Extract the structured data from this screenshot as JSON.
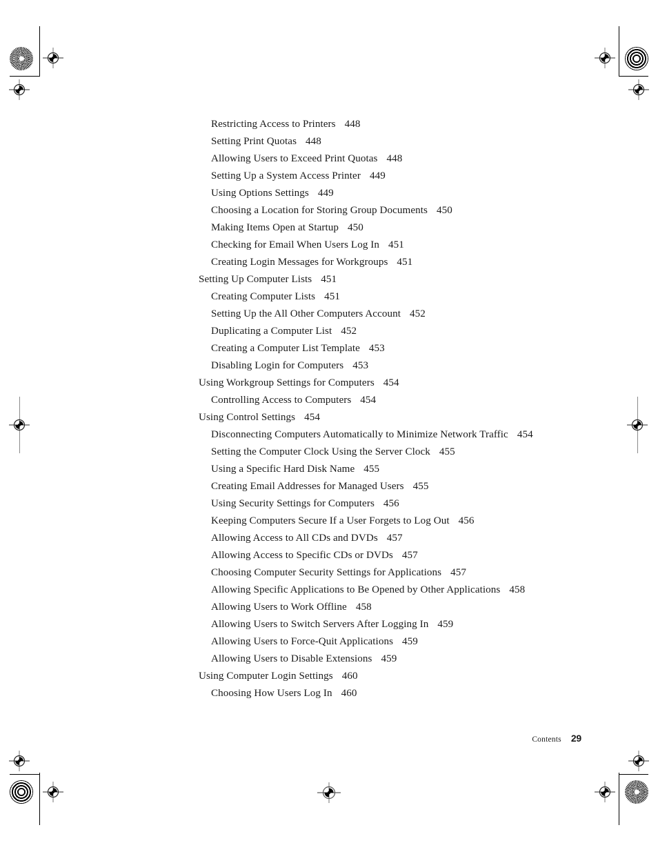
{
  "page": {
    "footer_label": "Contents",
    "page_number": "29"
  },
  "toc": {
    "entries": [
      {
        "title": "Restricting Access to Printers",
        "page": "448",
        "level": 2
      },
      {
        "title": "Setting Print Quotas",
        "page": "448",
        "level": 2
      },
      {
        "title": "Allowing Users to Exceed Print Quotas",
        "page": "448",
        "level": 2
      },
      {
        "title": "Setting Up a System Access Printer",
        "page": "449",
        "level": 2
      },
      {
        "title": "Using Options Settings",
        "page": "449",
        "level": 2
      },
      {
        "title": "Choosing a Location for Storing Group Documents",
        "page": "450",
        "level": 2
      },
      {
        "title": "Making Items Open at Startup",
        "page": "450",
        "level": 2
      },
      {
        "title": "Checking for Email When Users Log In",
        "page": "451",
        "level": 2
      },
      {
        "title": "Creating Login Messages for Workgroups",
        "page": "451",
        "level": 2
      },
      {
        "title": "Setting Up Computer Lists",
        "page": "451",
        "level": 1
      },
      {
        "title": "Creating Computer Lists",
        "page": "451",
        "level": 2
      },
      {
        "title": "Setting Up the All Other Computers Account",
        "page": "452",
        "level": 2
      },
      {
        "title": "Duplicating a Computer List",
        "page": "452",
        "level": 2
      },
      {
        "title": "Creating a Computer List Template",
        "page": "453",
        "level": 2
      },
      {
        "title": "Disabling Login for Computers",
        "page": "453",
        "level": 2
      },
      {
        "title": "Using Workgroup Settings for Computers",
        "page": "454",
        "level": 1
      },
      {
        "title": "Controlling Access to Computers",
        "page": "454",
        "level": 2
      },
      {
        "title": "Using Control Settings",
        "page": "454",
        "level": 1
      },
      {
        "title": "Disconnecting Computers Automatically to Minimize Network Traffic",
        "page": "454",
        "level": 2
      },
      {
        "title": "Setting the Computer Clock Using the Server Clock",
        "page": "455",
        "level": 2
      },
      {
        "title": "Using a Specific Hard Disk Name",
        "page": "455",
        "level": 2
      },
      {
        "title": "Creating Email Addresses for Managed Users",
        "page": "455",
        "level": 2
      },
      {
        "title": "Using Security Settings for Computers",
        "page": "456",
        "level": 2
      },
      {
        "title": "Keeping Computers Secure If a User Forgets to Log Out",
        "page": "456",
        "level": 2
      },
      {
        "title": "Allowing Access to All CDs and DVDs",
        "page": "457",
        "level": 2
      },
      {
        "title": "Allowing Access to Specific CDs or DVDs",
        "page": "457",
        "level": 2
      },
      {
        "title": "Choosing Computer Security Settings for Applications",
        "page": "457",
        "level": 2
      },
      {
        "title": "Allowing Specific Applications to Be Opened by Other Applications",
        "page": "458",
        "level": 2
      },
      {
        "title": "Allowing Users to Work Offline",
        "page": "458",
        "level": 2
      },
      {
        "title": "Allowing Users to Switch Servers After Logging In",
        "page": "459",
        "level": 2
      },
      {
        "title": "Allowing Users to Force-Quit Applications",
        "page": "459",
        "level": 2
      },
      {
        "title": "Allowing Users to Disable Extensions",
        "page": "459",
        "level": 2
      },
      {
        "title": "Using Computer Login Settings",
        "page": "460",
        "level": 1
      },
      {
        "title": "Choosing How Users Log In",
        "page": "460",
        "level": 2
      }
    ]
  }
}
